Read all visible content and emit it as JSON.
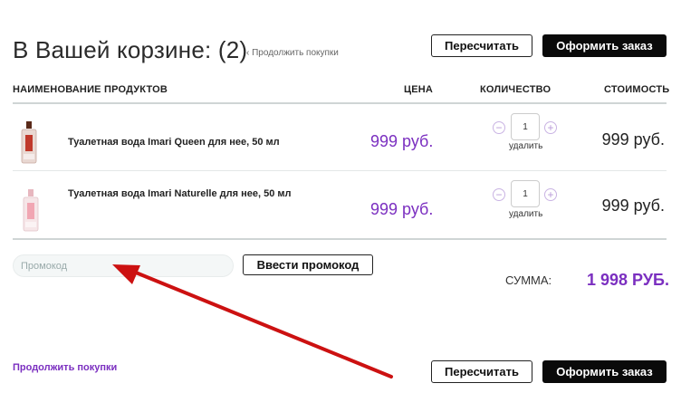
{
  "header": {
    "title": "В Вашей корзине: (2)",
    "continue_small": "‹ Продолжить покупки",
    "recalc_label": "Пересчитать",
    "checkout_label": "Оформить заказ"
  },
  "table": {
    "headers": {
      "product": "НАИМЕНОВАНИЕ ПРОДУКТОВ",
      "price": "ЦЕНА",
      "qty": "КОЛИЧЕСТВО",
      "cost": "СТОИМОСТЬ"
    },
    "rows": [
      {
        "name": "Туалетная вода Imari Queen для нее, 50 мл",
        "price": "999 руб.",
        "qty": "1",
        "remove": "удалить",
        "cost": "999 руб."
      },
      {
        "name": "Туалетная вода Imari Naturelle для нее, 50 мл",
        "price": "999 руб.",
        "qty": "1",
        "remove": "удалить",
        "cost": "999 руб."
      }
    ],
    "qty_minus": "−",
    "qty_plus": "+"
  },
  "promo": {
    "placeholder": "Промокод",
    "apply_label": "Ввести промокод"
  },
  "summary": {
    "label": "СУММА:",
    "value": "1 998 РУБ."
  },
  "footer": {
    "continue_label": "Продолжить покупки",
    "recalc_label": "Пересчитать",
    "checkout_label": "Оформить заказ"
  },
  "colors": {
    "accent": "#7b2fc0",
    "annotation_arrow": "#cc1111"
  }
}
